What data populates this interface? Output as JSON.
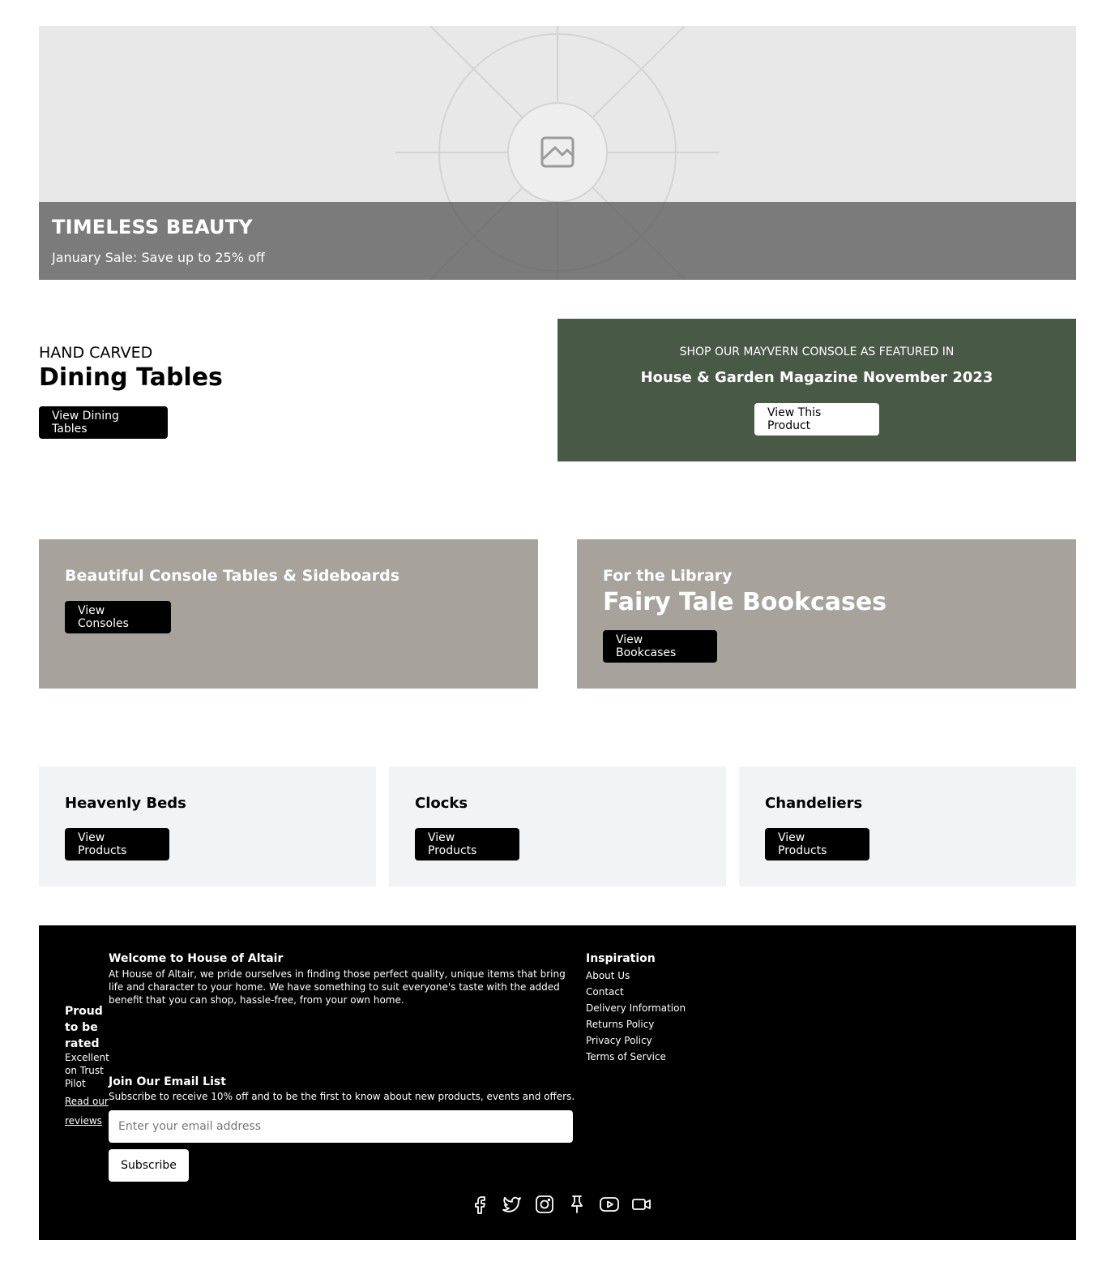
{
  "hero": {
    "title": "TIMELESS BEAUTY",
    "subtitle": "January Sale: Save up to 25% off",
    "image_icon": "image-placeholder-icon"
  },
  "dining": {
    "eyebrow": "HAND CARVED",
    "title": "Dining Tables",
    "button": "View Dining Tables"
  },
  "feature": {
    "eyebrow": "SHOP OUR MAYVERN CONSOLE AS FEATURED IN",
    "title": "House & Garden Magazine November 2023",
    "button": "View This Product",
    "bg_color": "#485a45"
  },
  "promos": {
    "consoles": {
      "title": "Beautiful Console Tables & Sideboards",
      "button": "View Consoles"
    },
    "bookcases": {
      "eyebrow": "For the Library",
      "title": "Fairy Tale Bookcases",
      "button": "View Bookcases"
    },
    "bg_color": "#a7a29c"
  },
  "categories": [
    {
      "title": "Heavenly Beds",
      "button": "View Products"
    },
    {
      "title": "Clocks",
      "button": "View Products"
    },
    {
      "title": "Chandeliers",
      "button": "View Products"
    }
  ],
  "footer": {
    "rating": {
      "heading": "Proud to be rated",
      "text": "Excellent on Trust Pilot",
      "link": "Read our reviews"
    },
    "welcome": {
      "heading": "Welcome to House of Altair",
      "text": "At House of Altair, we pride ourselves in finding those perfect quality, unique items that bring life and character to your home. We have something to suit everyone's taste with the added benefit that you can shop, hassle-free, from your own home."
    },
    "email": {
      "heading": "Join Our Email List",
      "text": "Subscribe to receive 10% off and to be the first to know about new products, events and offers.",
      "placeholder": "Enter your email address",
      "button": "Subscribe"
    },
    "inspiration": {
      "heading": "Inspiration",
      "links": [
        "About Us",
        "Contact",
        "Delivery Information",
        "Returns Policy",
        "Privacy Policy",
        "Terms of Service"
      ]
    },
    "socials": [
      "facebook-icon",
      "twitter-icon",
      "instagram-icon",
      "pinterest-icon",
      "youtube-icon",
      "video-icon"
    ]
  }
}
